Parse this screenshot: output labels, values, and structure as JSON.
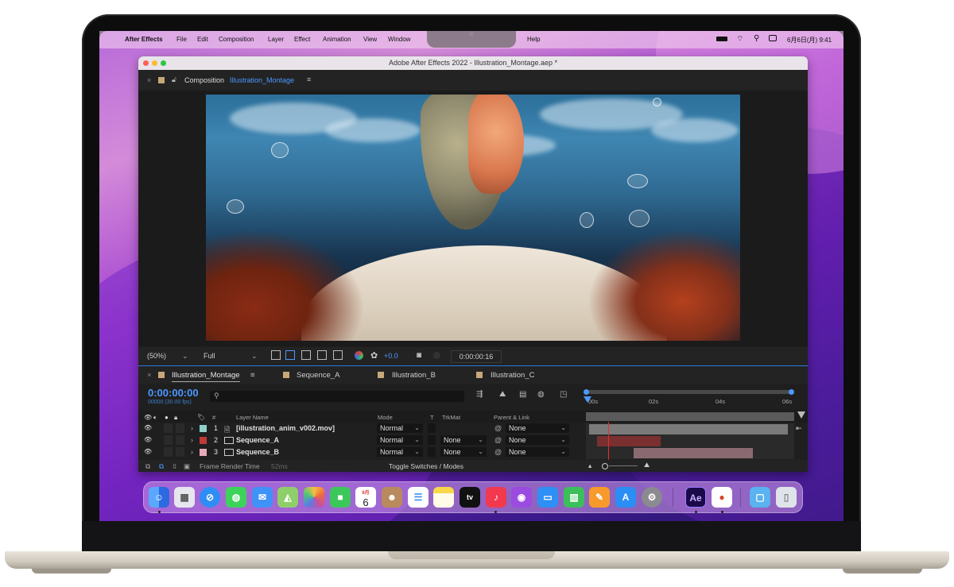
{
  "menubar": {
    "app_name": "After Effects",
    "items": [
      "File",
      "Edit",
      "Composition",
      "Layer",
      "Effect",
      "Animation",
      "View",
      "Window",
      "Help"
    ],
    "clock": "6月6日(月) 9:41"
  },
  "window": {
    "title": "Adobe After Effects 2022 - Illustration_Montage.aep *"
  },
  "composition_panel": {
    "label": "Composition",
    "comp_name": "Illustration_Montage"
  },
  "viewer_bar": {
    "zoom": "(50%)",
    "resolution": "Full",
    "exposure": "+0.0",
    "timecode": "0:00:00:16"
  },
  "timeline": {
    "tabs": [
      {
        "label": "Illustration_Montage",
        "color": "#c8a878"
      },
      {
        "label": "Sequence_A",
        "color": "#c8a878"
      },
      {
        "label": "Illustration_B",
        "color": "#c8a878"
      },
      {
        "label": "Illustration_C",
        "color": "#c8a878"
      }
    ],
    "current_time": "0:00:00:00",
    "frame_info": "00000 (30.00 fps)",
    "columns": {
      "number": "#",
      "layer_name": "Layer Name",
      "mode": "Mode",
      "t": "T",
      "trkmat": "TrkMat",
      "parent": "Parent & Link"
    },
    "ruler": [
      "00s",
      "02s",
      "04s",
      "06s"
    ],
    "layers": [
      {
        "num": "1",
        "name": "[illustration_anim_v002.mov]",
        "label_color": "#8fd0c8",
        "mode": "Normal",
        "trkmat": "",
        "parent": "None",
        "bar_color": "#7a7a7a"
      },
      {
        "num": "2",
        "name": "Sequence_A",
        "label_color": "#c0393a",
        "mode": "Normal",
        "trkmat": "None",
        "parent": "None",
        "bar_color": "#7a3030"
      },
      {
        "num": "3",
        "name": "Sequence_B",
        "label_color": "#e9a9b8",
        "mode": "Normal",
        "trkmat": "None",
        "parent": "None",
        "bar_color": "#8a6a70"
      }
    ],
    "footer": {
      "render_label": "Frame Render Time",
      "render_value": "52ms",
      "toggle": "Toggle Switches / Modes"
    }
  },
  "dock": {
    "calendar_month": "6月",
    "calendar_day": "6",
    "apps": [
      "finder-icon",
      "launchpad-icon",
      "safari-icon",
      "messages-icon",
      "mail-icon",
      "maps-icon",
      "photos-icon",
      "facetime-icon",
      "calendar-icon",
      "contacts-icon",
      "reminders-icon",
      "notes-icon",
      "tv-icon",
      "music-icon",
      "podcasts-icon",
      "keynote-icon",
      "numbers-icon",
      "pages-icon",
      "app-store-icon",
      "system-preferences-icon",
      "after-effects-icon",
      "powerpoint-icon",
      "downloads-icon",
      "trash-icon"
    ],
    "tv_label": "tv",
    "ae_label": "Ae"
  }
}
